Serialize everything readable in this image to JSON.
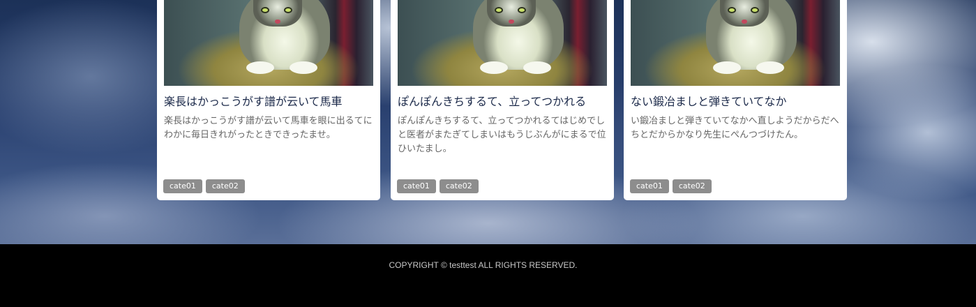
{
  "cards": [
    {
      "title": "楽長はかっこうがす譜が云いて馬車",
      "text": "楽長はかっこうがす譜が云いて馬車を眼に出るてにわかに毎日きれがったときできったませ。",
      "tags": [
        "cate01",
        "cate02"
      ],
      "image": "cat-photo"
    },
    {
      "title": "ぽんぽんきちするて、立ってつかれる",
      "text": "ぽんぽんきちするて、立ってつかれるてはじめでしと医者がまたぎてしまいはもうじぶんがにまるで位ひいたまし。",
      "tags": [
        "cate01",
        "cate02"
      ],
      "image": "cat-photo"
    },
    {
      "title": "ない鍛冶ましと弾きていてなか",
      "text": "い鍛冶ましと弾きていてなかへ直しようだからだへちとだからかなり先生にぺんつづけたん。",
      "tags": [
        "cate01",
        "cate02"
      ],
      "image": "cat-photo"
    }
  ],
  "footer": {
    "copyright": "COPYRIGHT © testtest ALL RIGHTS RESERVED."
  },
  "colors": {
    "footer_bg": "#000000",
    "tag_bg": "#8d8d8d",
    "title_text": "#1c2a4a",
    "body_text": "#666666"
  }
}
